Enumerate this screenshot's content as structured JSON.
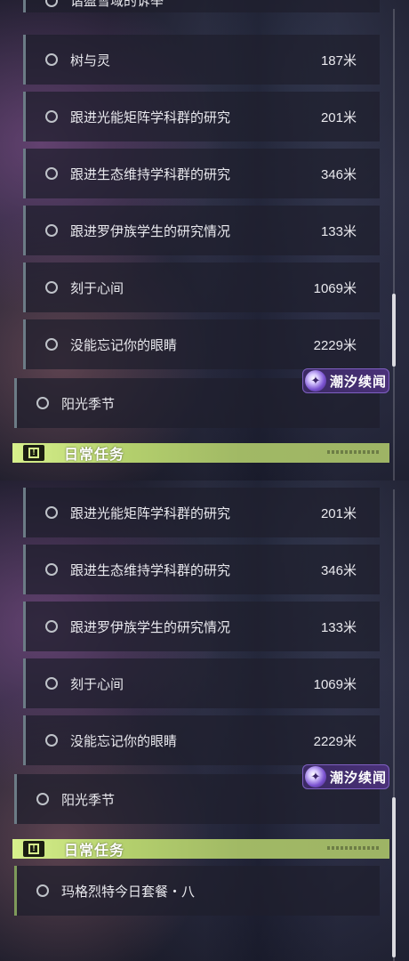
{
  "quests_top": [
    {
      "name": "谐盈雪域的诉举",
      "distance": ""
    },
    {
      "name": "树与灵",
      "distance": "187米"
    },
    {
      "name": "跟进光能矩阵学科群的研究",
      "distance": "201米"
    },
    {
      "name": "跟进生态维持学科群的研究",
      "distance": "346米"
    },
    {
      "name": "跟进罗伊族学生的研究情况",
      "distance": "133米"
    },
    {
      "name": "刻于心间",
      "distance": "1069米"
    },
    {
      "name": "没能忘记你的眼睛",
      "distance": "2229米"
    }
  ],
  "quests_bottom": [
    {
      "name": "跟进光能矩阵学科群的研究",
      "distance": "201米"
    },
    {
      "name": "跟进生态维持学科群的研究",
      "distance": "346米"
    },
    {
      "name": "跟进罗伊族学生的研究情况",
      "distance": "133米"
    },
    {
      "name": "刻于心间",
      "distance": "1069米"
    },
    {
      "name": "没能忘记你的眼睛",
      "distance": "2229米"
    }
  ],
  "season_quest": {
    "name": "阳光季节"
  },
  "badge": {
    "text": "潮汐续闻",
    "icon": "tide-orb-icon"
  },
  "daily_section": {
    "title": "日常任务",
    "icon": "exclamation-box-icon"
  },
  "daily_quest": {
    "name": "玛格烈特今日套餐・八"
  },
  "colors": {
    "accent_green": "#d7f08c",
    "badge_purple": "#4a3179",
    "row_border": "#6c7c86"
  }
}
